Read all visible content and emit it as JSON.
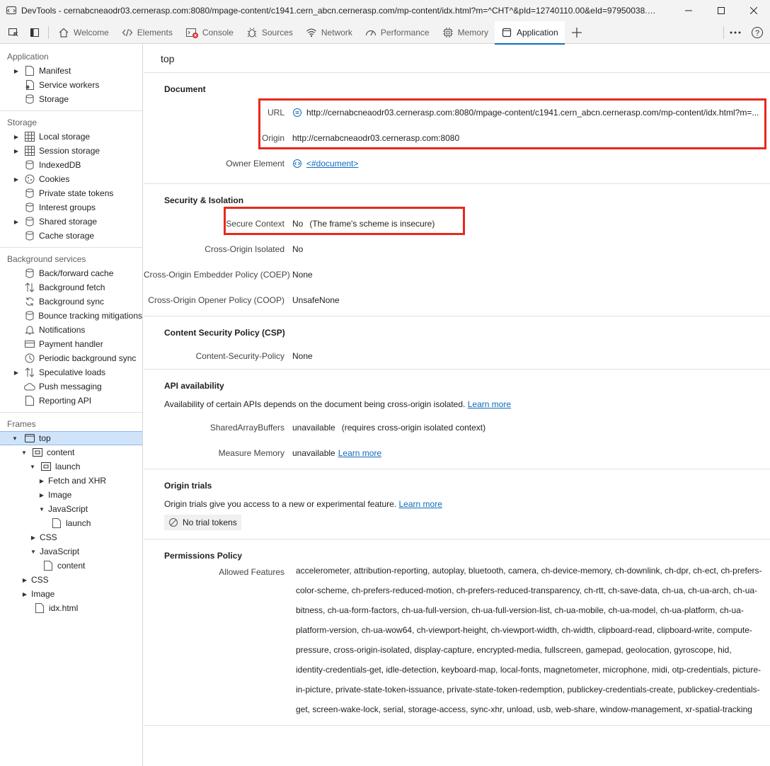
{
  "window": {
    "title": "DevTools - cernabcneaodr03.cernerasp.com:8080/mpage-content/c1941.cern_abcn.cernerasp.com/mp-content/idx.html?m=^CHT^&pId=12740110.00&eId=97950038.00&..."
  },
  "tabs": [
    {
      "label": "Welcome",
      "icon": "home-icon"
    },
    {
      "label": "Elements",
      "icon": "code-icon"
    },
    {
      "label": "Console",
      "icon": "console-icon"
    },
    {
      "label": "Sources",
      "icon": "bug-icon"
    },
    {
      "label": "Network",
      "icon": "wifi-icon"
    },
    {
      "label": "Performance",
      "icon": "performance-icon"
    },
    {
      "label": "Memory",
      "icon": "memory-chip-icon"
    },
    {
      "label": "Application",
      "icon": "application-icon",
      "active": true
    }
  ],
  "sidebar": {
    "application": {
      "title": "Application",
      "items": [
        "Manifest",
        "Service workers",
        "Storage"
      ]
    },
    "storage": {
      "title": "Storage",
      "items": [
        "Local storage",
        "Session storage",
        "IndexedDB",
        "Cookies",
        "Private state tokens",
        "Interest groups",
        "Shared storage",
        "Cache storage"
      ]
    },
    "background": {
      "title": "Background services",
      "items": [
        "Back/forward cache",
        "Background fetch",
        "Background sync",
        "Bounce tracking mitigations",
        "Notifications",
        "Payment handler",
        "Periodic background sync",
        "Speculative loads",
        "Push messaging",
        "Reporting API"
      ]
    },
    "frames": {
      "title": "Frames",
      "items": [
        "top",
        "content",
        "launch",
        "Fetch and XHR",
        "Image",
        "JavaScript",
        "launch",
        "CSS",
        "JavaScript",
        "content",
        "CSS",
        "Image",
        "idx.html"
      ]
    }
  },
  "main": {
    "title": "top",
    "document": {
      "heading": "Document",
      "url_label": "URL",
      "url_value": "http://cernabcneaodr03.cernerasp.com:8080/mpage-content/c1941.cern_abcn.cernerasp.com/mp-content/idx.html?m=...",
      "origin_label": "Origin",
      "origin_value": "http://cernabcneaodr03.cernerasp.com:8080",
      "owner_label": "Owner Element",
      "owner_value": "<#document>"
    },
    "security": {
      "heading": "Security & Isolation",
      "secure_label": "Secure Context",
      "secure_value": "No",
      "secure_reason": "(The frame's scheme is insecure)",
      "coi_label": "Cross-Origin Isolated",
      "coi_value": "No",
      "coep_label": "Cross-Origin Embedder Policy (COEP)",
      "coep_value": "None",
      "coop_label": "Cross-Origin Opener Policy (COOP)",
      "coop_value": "UnsafeNone"
    },
    "csp": {
      "heading": "Content Security Policy (CSP)",
      "label": "Content-Security-Policy",
      "value": "None"
    },
    "api": {
      "heading": "API availability",
      "desc": "Availability of certain APIs depends on the document being cross-origin isolated.",
      "learn_more": "Learn more",
      "sab_label": "SharedArrayBuffers",
      "sab_value": "unavailable",
      "sab_note": "(requires cross-origin isolated context)",
      "mm_label": "Measure Memory",
      "mm_value": "unavailable",
      "mm_link": "Learn more"
    },
    "trials": {
      "heading": "Origin trials",
      "desc": "Origin trials give you access to a new or experimental feature.",
      "learn_more": "Learn more",
      "chip": "No trial tokens"
    },
    "permissions": {
      "heading": "Permissions Policy",
      "label": "Allowed Features",
      "value": "accelerometer, attribution-reporting, autoplay, bluetooth, camera, ch-device-memory, ch-downlink, ch-dpr, ch-ect, ch-prefers-color-scheme, ch-prefers-reduced-motion, ch-prefers-reduced-transparency, ch-rtt, ch-save-data, ch-ua, ch-ua-arch, ch-ua-bitness, ch-ua-form-factors, ch-ua-full-version, ch-ua-full-version-list, ch-ua-mobile, ch-ua-model, ch-ua-platform, ch-ua-platform-version, ch-ua-wow64, ch-viewport-height, ch-viewport-width, ch-width, clipboard-read, clipboard-write, compute-pressure, cross-origin-isolated, display-capture, encrypted-media, fullscreen, gamepad, geolocation, gyroscope, hid, identity-credentials-get, idle-detection, keyboard-map, local-fonts, magnetometer, microphone, midi, otp-credentials, picture-in-picture, private-state-token-issuance, private-state-token-redemption, publickey-credentials-create, publickey-credentials-get, screen-wake-lock, serial, storage-access, sync-xhr, unload, usb, web-share, window-management, xr-spatial-tracking"
    }
  },
  "colors": {
    "accent": "#0f6cbd",
    "highlight": "#e8281e",
    "selected": "#cfe4fa"
  }
}
